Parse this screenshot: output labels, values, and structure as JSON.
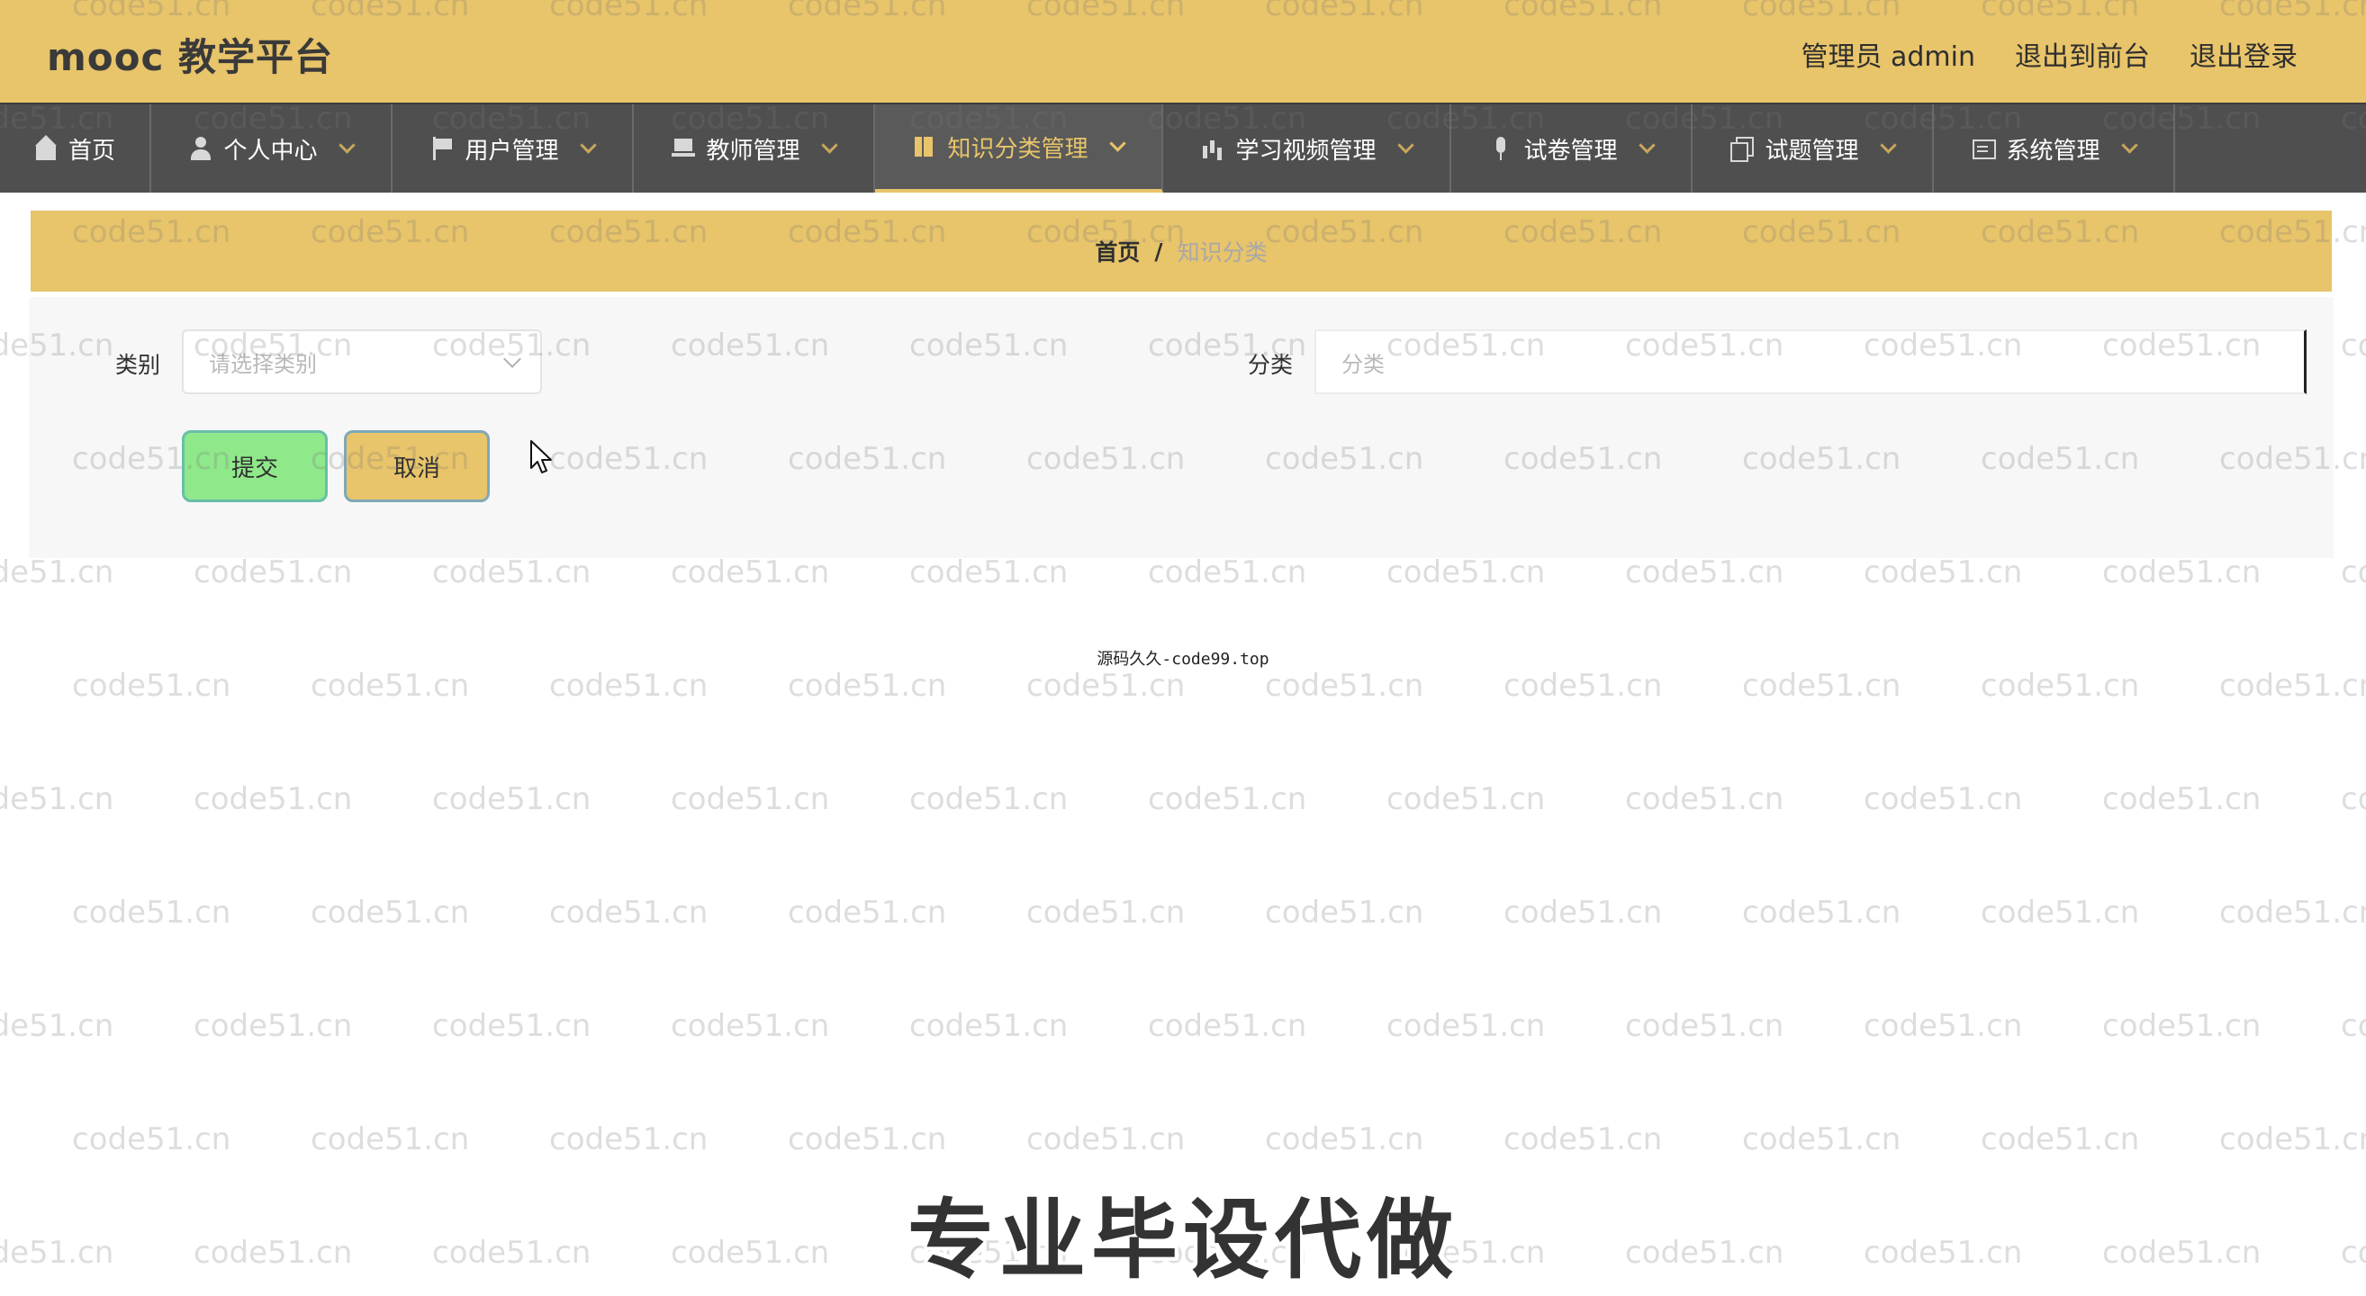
{
  "app": {
    "title": "mooc 教学平台",
    "user_role_label": "管理员 admin",
    "to_front_label": "退出到前台",
    "logout_label": "退出登录"
  },
  "nav": {
    "items": [
      {
        "label": "首页",
        "icon": "home-icon"
      },
      {
        "label": "个人中心",
        "icon": "user-icon"
      },
      {
        "label": "用户管理",
        "icon": "flag-icon"
      },
      {
        "label": "教师管理",
        "icon": "laptop-icon"
      },
      {
        "label": "知识分类管理",
        "icon": "book-icon",
        "active": true
      },
      {
        "label": "学习视频管理",
        "icon": "bar-chart-icon"
      },
      {
        "label": "试卷管理",
        "icon": "microphone-icon"
      },
      {
        "label": "试题管理",
        "icon": "copy-icon"
      },
      {
        "label": "系统管理",
        "icon": "system-icon"
      }
    ]
  },
  "breadcrumb": {
    "home": "首页",
    "separator": "/",
    "current": "知识分类"
  },
  "form": {
    "category_label": "类别",
    "category_placeholder": "请选择类别",
    "classification_label": "分类",
    "classification_placeholder": "分类",
    "submit_label": "提交",
    "cancel_label": "取消"
  },
  "footer": {
    "text": "源码久久-code99.top"
  },
  "overlay": {
    "watermark_text": "code51.cn",
    "promo_text": "专业毕设代做"
  },
  "colors": {
    "header_bg": "#e8c46a",
    "nav_bg": "#4f4f4f",
    "accent": "#e8c46a",
    "submit_bg": "#8fe88a"
  }
}
